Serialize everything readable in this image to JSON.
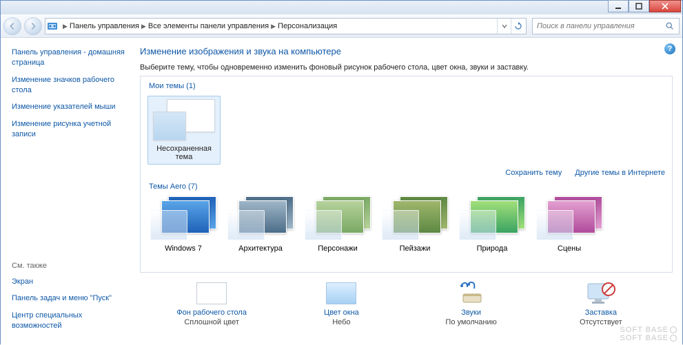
{
  "title_buttons": {
    "min": "minimize",
    "max": "maximize",
    "close": "close"
  },
  "breadcrumbs": {
    "items": [
      "Панель управления",
      "Все элементы панели управления",
      "Персонализация"
    ]
  },
  "search": {
    "placeholder": "Поиск в панели управления"
  },
  "sidebar": {
    "links": [
      "Панель управления - домашняя страница",
      "Изменение значков рабочего стола",
      "Изменение указателей мыши",
      "Изменение рисунка учетной записи"
    ],
    "see_also_header": "См. также",
    "see_also": [
      "Экран",
      "Панель задач и меню \"Пуск\"",
      "Центр специальных возможностей"
    ]
  },
  "main": {
    "heading": "Изменение изображения и звука на компьютере",
    "description": "Выберите тему, чтобы одновременно изменить фоновый рисунок рабочего стола, цвет окна, звуки и заставку.",
    "my_themes_title": "Мои темы (1)",
    "unsaved_theme": "Несохраненная тема",
    "links": {
      "save": "Сохранить тему",
      "online": "Другие темы в Интернете"
    },
    "aero_title": "Темы Aero (7)",
    "aero_items": [
      {
        "label": "Windows 7",
        "c1": "#1e62b8",
        "c2": "#5aa4e8"
      },
      {
        "label": "Архитектура",
        "c1": "#4c6d88",
        "c2": "#9fb6c8"
      },
      {
        "label": "Персонажи",
        "c1": "#7aa964",
        "c2": "#b6d29b"
      },
      {
        "label": "Пейзажи",
        "c1": "#5d8843",
        "c2": "#9fb76c"
      },
      {
        "label": "Природа",
        "c1": "#3aa362",
        "c2": "#a2e07a"
      },
      {
        "label": "Сцены",
        "c1": "#b04b9b",
        "c2": "#e3a0d1"
      }
    ]
  },
  "bottom": {
    "items": [
      {
        "label": "Фон рабочего стола",
        "value": "Сплошной цвет",
        "icon": "desktop-bg"
      },
      {
        "label": "Цвет окна",
        "value": "Небо",
        "icon": "window-color"
      },
      {
        "label": "Звуки",
        "value": "По умолчанию",
        "icon": "sounds"
      },
      {
        "label": "Заставка",
        "value": "Отсутствует",
        "icon": "screensaver"
      }
    ]
  },
  "watermark": "SOFT   BASE"
}
